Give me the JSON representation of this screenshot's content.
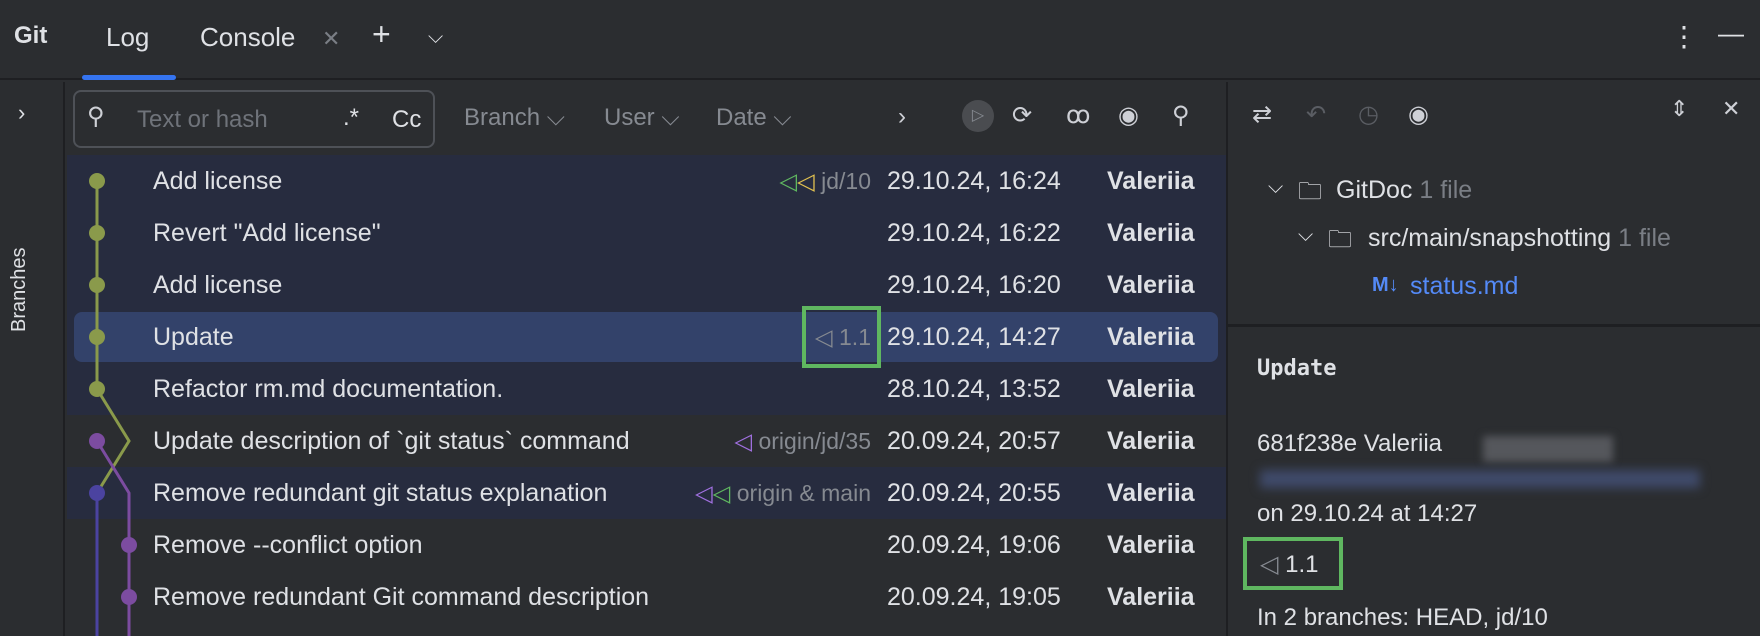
{
  "toolwindow": {
    "title": "Git",
    "tabs": [
      {
        "label": "Log"
      },
      {
        "label": "Console"
      }
    ],
    "active_tab": "Log"
  },
  "sidebar": {
    "label": "Branches"
  },
  "filters": {
    "search_placeholder": "Text or hash",
    "regex": ".*",
    "case": "Cc",
    "branch": "Branch",
    "user": "User",
    "date": "Date"
  },
  "commits": [
    {
      "subject": "Add license",
      "ref": "jd/10",
      "date": "29.10.24, 16:24",
      "author": "Valeriia"
    },
    {
      "subject": "Revert \"Add license\"",
      "ref": "",
      "date": "29.10.24, 16:22",
      "author": "Valeriia"
    },
    {
      "subject": "Add license",
      "ref": "",
      "date": "29.10.24, 16:20",
      "author": "Valeriia"
    },
    {
      "subject": "Update",
      "ref": "1.1",
      "date": "29.10.24, 14:27",
      "author": "Valeriia"
    },
    {
      "subject": "Refactor rm.md documentation.",
      "ref": "",
      "date": "28.10.24, 13:52",
      "author": "Valeriia"
    },
    {
      "subject": "Update description of `git status` command",
      "ref": "origin/jd/35",
      "date": "20.09.24, 20:57",
      "author": "Valeriia"
    },
    {
      "subject": "Remove redundant git status explanation",
      "ref": "origin & main",
      "date": "20.09.24, 20:55",
      "author": "Valeriia"
    },
    {
      "subject": "Remove --conflict option",
      "ref": "",
      "date": "20.09.24, 19:06",
      "author": "Valeriia"
    },
    {
      "subject": "Remove redundant Git command description",
      "ref": "",
      "date": "20.09.24, 19:05",
      "author": "Valeriia"
    }
  ],
  "changes": {
    "root": "GitDoc",
    "root_count": "1 file",
    "folder": "src/main/snapshotting",
    "folder_count": "1 file",
    "file": "status.md",
    "file_badge": "M↓"
  },
  "details": {
    "subject": "Update",
    "hash_author": "681f238e Valeriia",
    "date_line": "on 29.10.24 at 14:27",
    "tag": "1.1",
    "branches": "In 2 branches: HEAD, jd/10"
  },
  "colors": {
    "accent": "#3574f0",
    "graph_green": "#8a9a4b",
    "graph_purple": "#7c4ca0",
    "graph_blue": "#4b43a0",
    "highlight": "#5fb760"
  }
}
